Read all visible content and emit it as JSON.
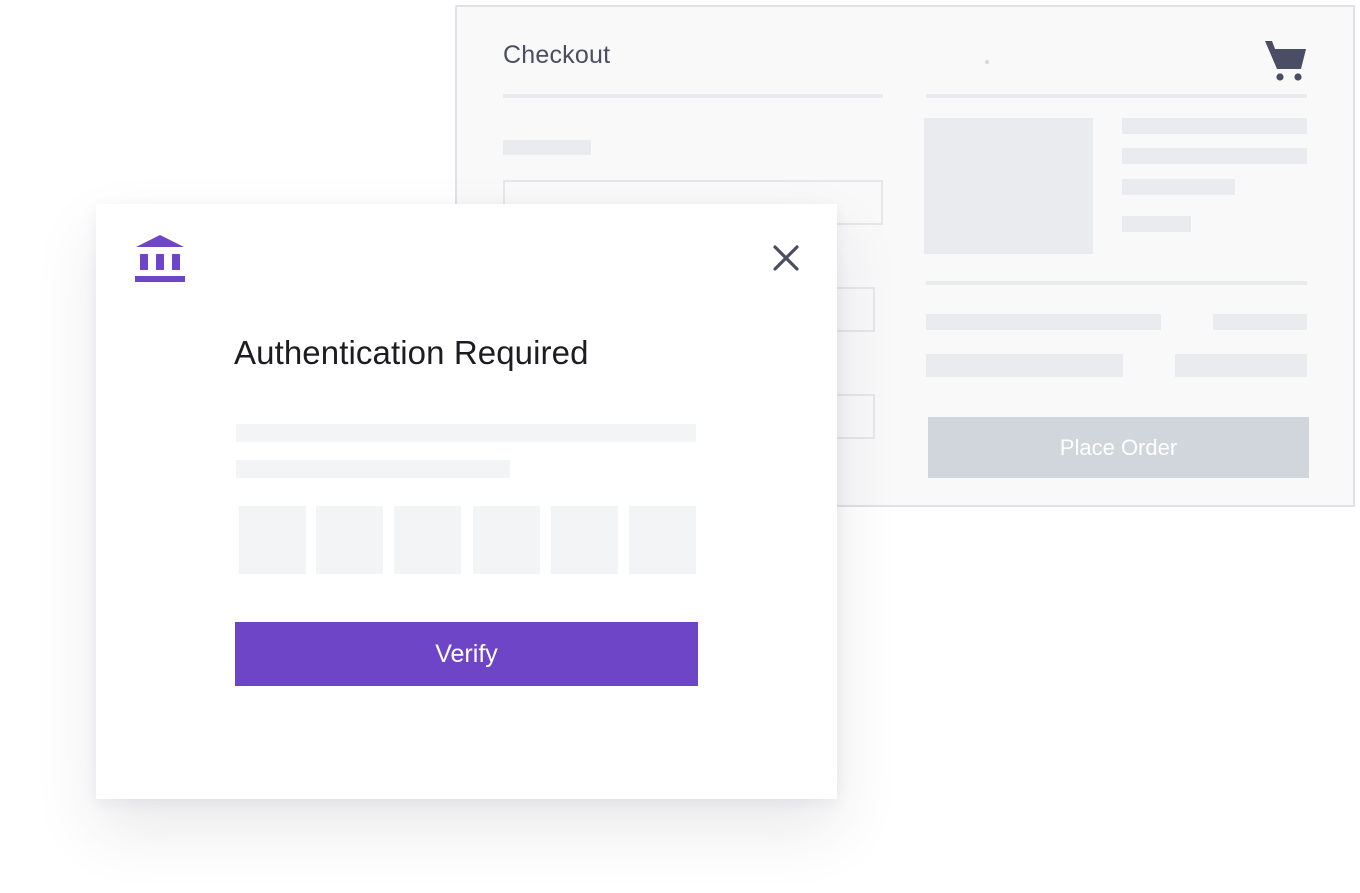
{
  "checkout": {
    "title": "Checkout",
    "cart_icon": "shopping-cart-icon",
    "place_order_label": "Place Order",
    "place_order_bg": "#d1d5dc"
  },
  "modal": {
    "bank_icon": "bank-icon",
    "close_icon": "close-icon",
    "title": "Authentication Required",
    "code_boxes": [
      "",
      "",
      "",
      "",
      "",
      ""
    ],
    "verify_label": "Verify",
    "accent_color": "#6e45c7"
  }
}
